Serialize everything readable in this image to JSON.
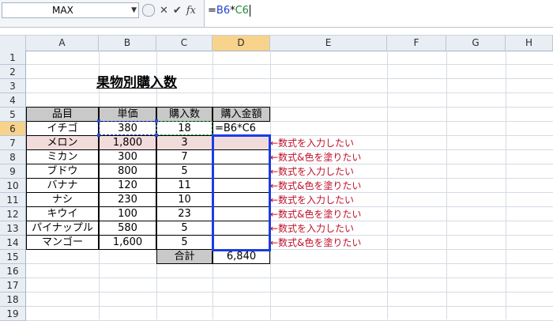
{
  "formula_bar": {
    "name_box": "MAX",
    "cancel": "✕",
    "enter": "✔",
    "fx": "fx",
    "formula_parts": [
      "=",
      "B6",
      "*",
      "C6"
    ]
  },
  "columns": [
    "A",
    "B",
    "C",
    "D",
    "E",
    "F",
    "G",
    "H"
  ],
  "rows": [
    "1",
    "2",
    "3",
    "4",
    "5",
    "6",
    "7",
    "8",
    "9",
    "10",
    "11",
    "12",
    "13",
    "14",
    "15",
    "16",
    "17",
    "18",
    "19"
  ],
  "sheet": {
    "title": "果物別購入数",
    "headers": [
      "品目",
      "単価",
      "購入数",
      "購入金額"
    ],
    "items": [
      {
        "name": "イチゴ",
        "price": "380",
        "qty": "18",
        "amount": "=B6*C6"
      },
      {
        "name": "メロン",
        "price": "1,800",
        "qty": "3",
        "amount": ""
      },
      {
        "name": "ミカン",
        "price": "300",
        "qty": "7",
        "amount": ""
      },
      {
        "name": "ブドウ",
        "price": "800",
        "qty": "5",
        "amount": ""
      },
      {
        "name": "バナナ",
        "price": "120",
        "qty": "11",
        "amount": ""
      },
      {
        "name": "ナシ",
        "price": "230",
        "qty": "10",
        "amount": ""
      },
      {
        "name": "キウイ",
        "price": "100",
        "qty": "23",
        "amount": ""
      },
      {
        "name": "パイナップル",
        "price": "580",
        "qty": "5",
        "amount": ""
      },
      {
        "name": "マンゴー",
        "price": "1,600",
        "qty": "5",
        "amount": ""
      }
    ],
    "total_label": "合計",
    "total_value": "6,840"
  },
  "notes": [
    "←数式を入力したい",
    "←数式&色を塗りたい",
    "←数式を入力したい",
    "←数式&色を塗りたい",
    "←数式を入力したい",
    "←数式&色を塗りたい",
    "←数式を入力したい",
    "←数式&色を塗りたい"
  ],
  "colors": {
    "selected_header": "#f8d38c",
    "pink_row": "#f2dcdb",
    "highlight_box": "#1a3de6",
    "note_text": "#c0102a"
  }
}
